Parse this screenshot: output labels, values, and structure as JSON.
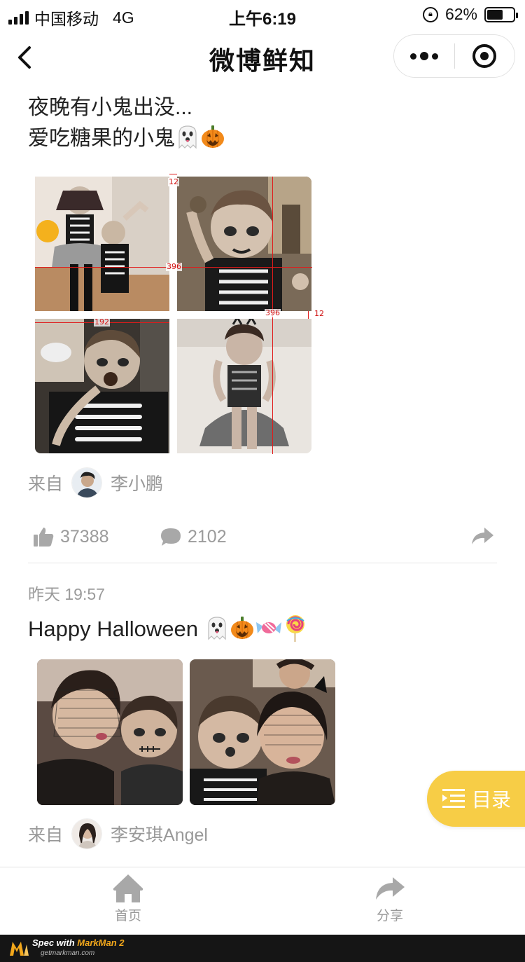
{
  "status_bar": {
    "carrier": "中国移动",
    "network": "4G",
    "time": "上午6:19",
    "battery": "62%",
    "battery_level": 0.62
  },
  "nav": {
    "title": "微博鲜知"
  },
  "posts": [
    {
      "text_line1": "夜晚有小鬼出没...",
      "text_line2": "爱吃糖果的小鬼",
      "text_line2_emojis": [
        "ghost",
        "pumpkin"
      ],
      "source_prefix": "来自",
      "source_name": "李小鹏",
      "likes": "37388",
      "comments": "2102",
      "spec_labels": {
        "gap_top": "12",
        "width_total": "396",
        "height_total": "396",
        "gap_right": "12",
        "cell_width": "192"
      }
    },
    {
      "date": "昨天 19:57",
      "text": "Happy Halloween ",
      "text_emojis": [
        "ghost",
        "pumpkin",
        "candy",
        "lollipop"
      ],
      "source_prefix": "来自",
      "source_name": "李安琪Angel"
    }
  ],
  "toc_button": {
    "label": "目录",
    "color": "#f7cd46"
  },
  "tabbar": {
    "home_label": "首页",
    "share_label": "分享"
  },
  "markman": {
    "title_prefix": "Spec with ",
    "title_brand": "MarkMan 2",
    "url": "getmarkman.com"
  }
}
